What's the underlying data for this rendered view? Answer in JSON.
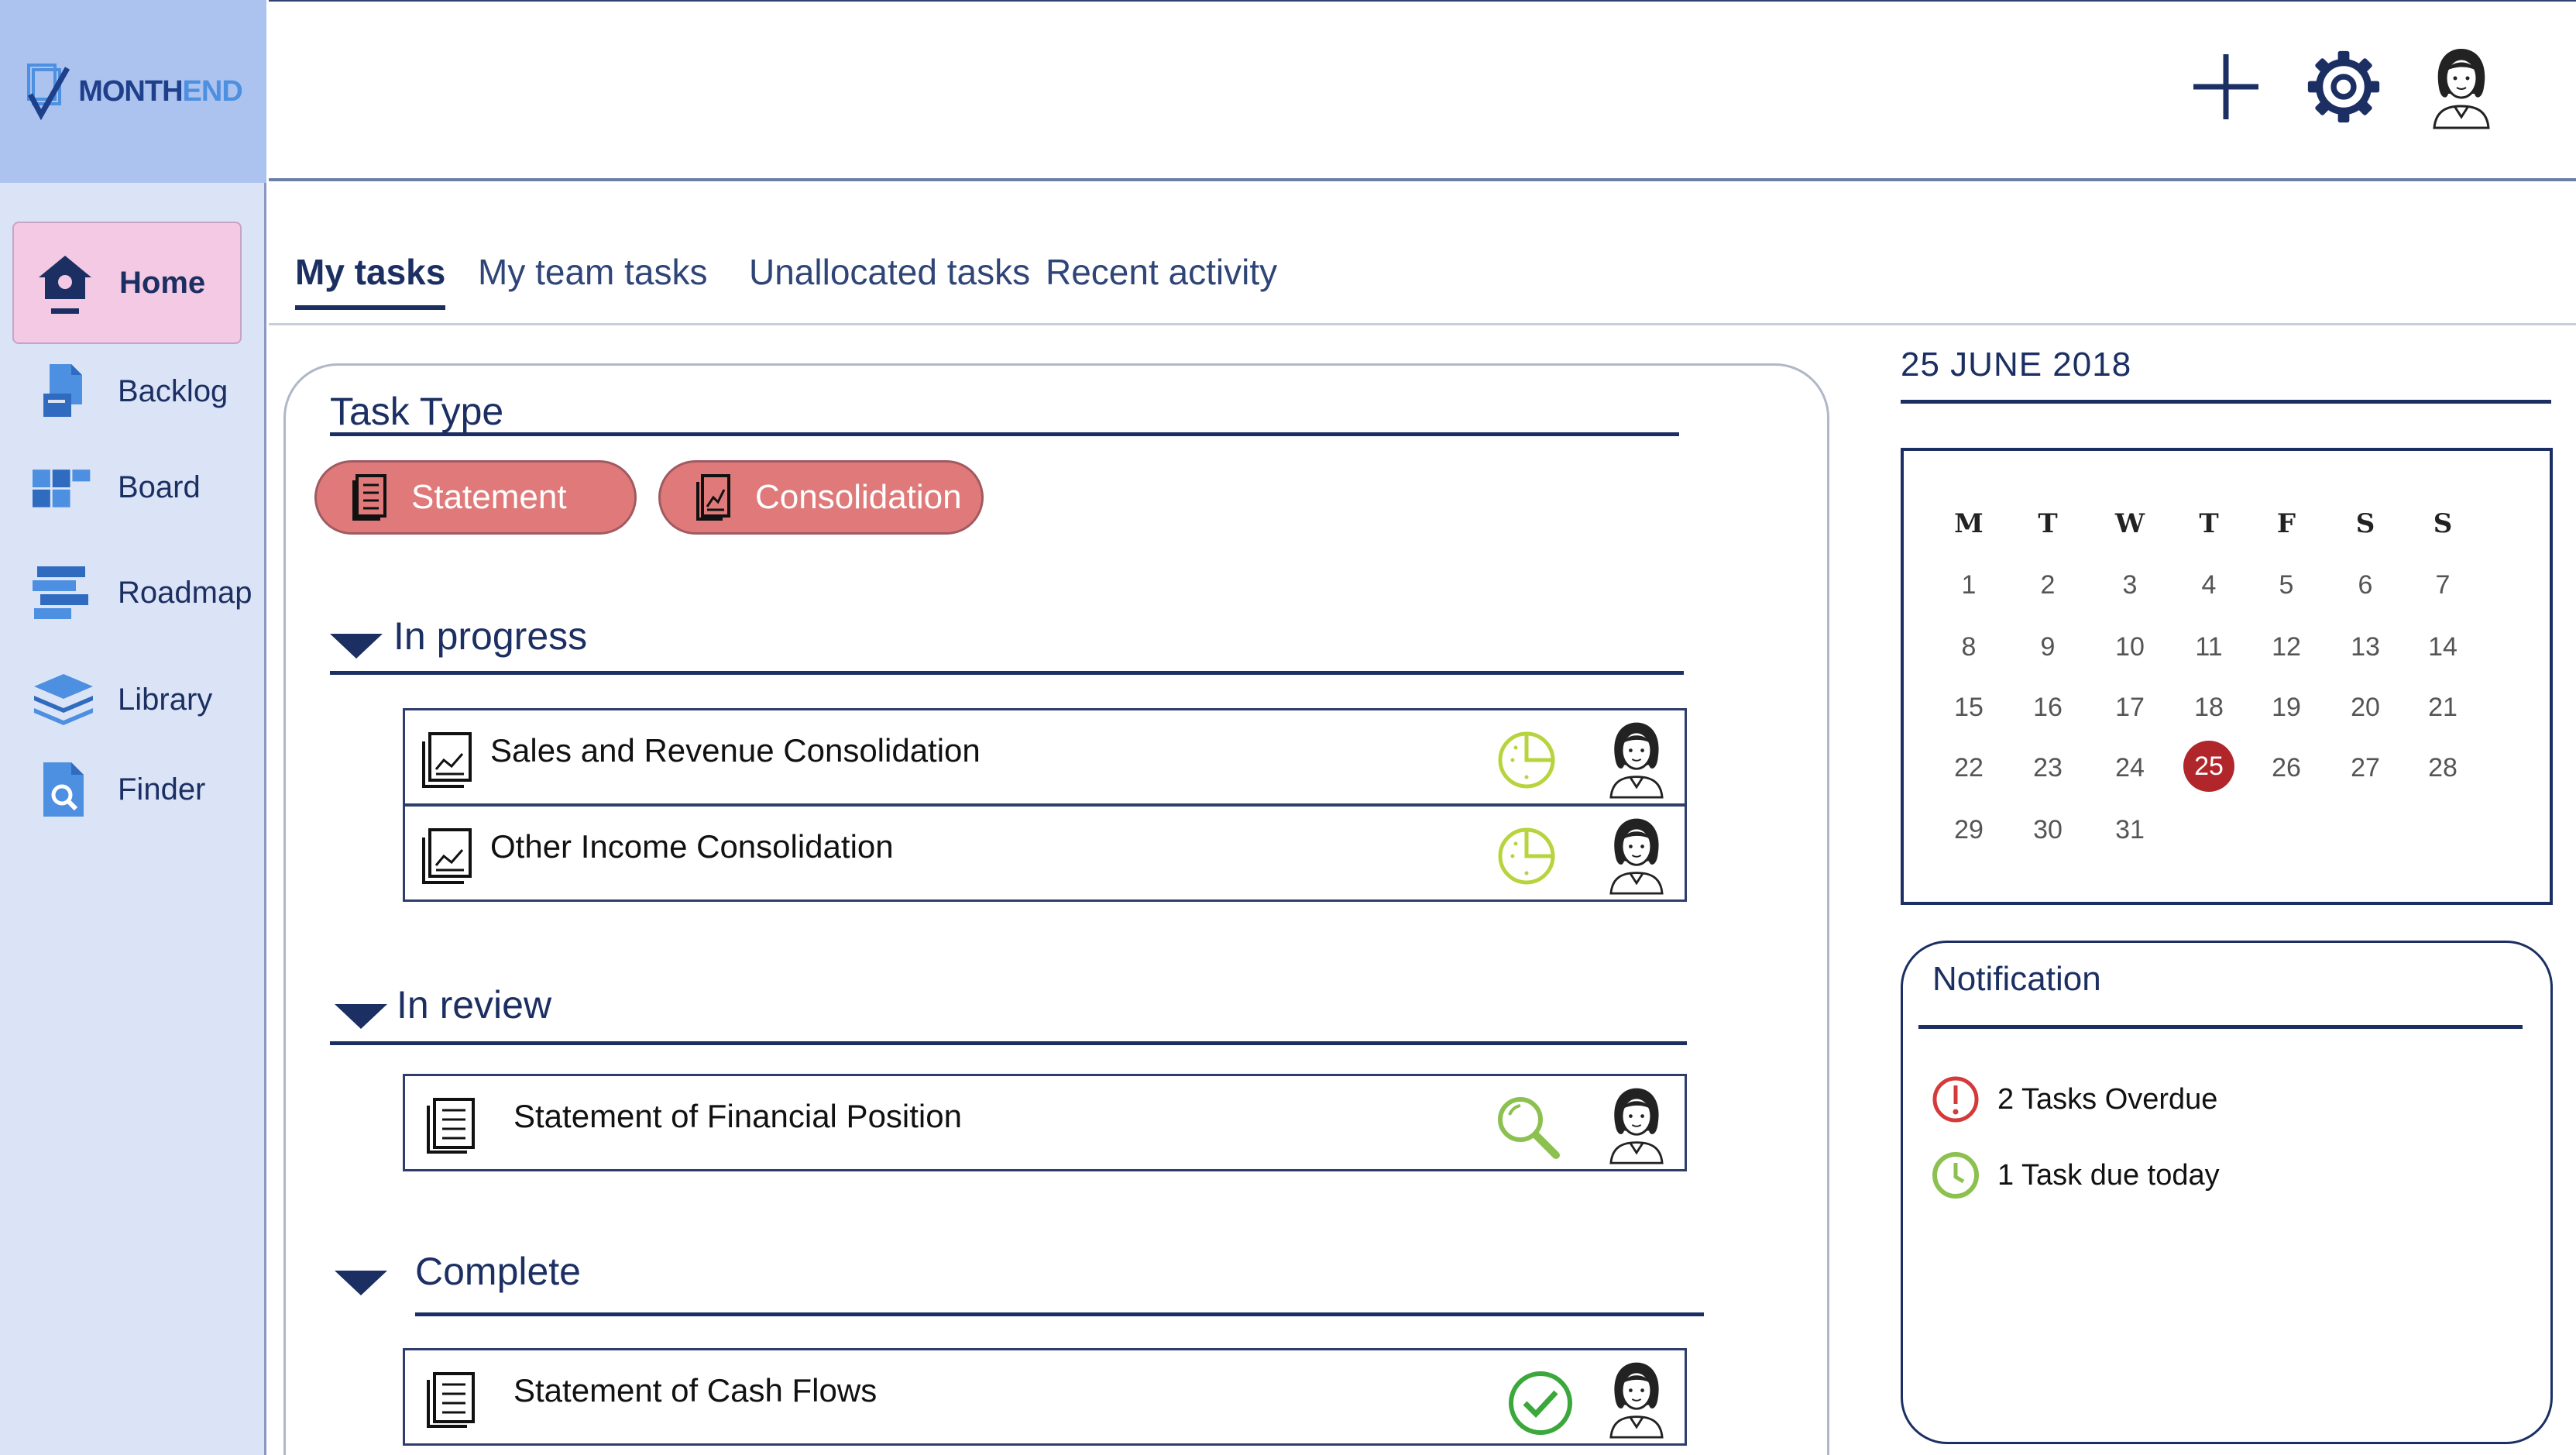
{
  "app": {
    "logo_text_a": "MONTH",
    "logo_text_b": "END"
  },
  "sidebar": {
    "items": [
      {
        "label": "Home",
        "icon": "house-icon",
        "active": true
      },
      {
        "label": "Backlog",
        "icon": "document-stack-icon"
      },
      {
        "label": "Board",
        "icon": "board-grid-icon"
      },
      {
        "label": "Roadmap",
        "icon": "roadmap-bars-icon"
      },
      {
        "label": "Library",
        "icon": "layers-icon"
      },
      {
        "label": "Finder",
        "icon": "document-search-icon"
      }
    ]
  },
  "header": {
    "actions": [
      "plus-icon",
      "gear-icon",
      "user-avatar-icon"
    ]
  },
  "tabs": [
    {
      "label": "My tasks",
      "active": true
    },
    {
      "label": "My team tasks"
    },
    {
      "label": "Unallocated tasks"
    },
    {
      "label": "Recent activity"
    }
  ],
  "task_type": {
    "heading": "Task Type",
    "chips": [
      {
        "label": "Statement",
        "icon": "statement-doc-icon"
      },
      {
        "label": "Consolidation",
        "icon": "consolidation-doc-icon"
      }
    ]
  },
  "sections": [
    {
      "title": "In progress",
      "tasks": [
        {
          "name": "Sales and Revenue Consolidation",
          "type_icon": "chart-doc-icon",
          "status_icon": "progress-clock-icon"
        },
        {
          "name": "Other Income Consolidation",
          "type_icon": "chart-doc-icon",
          "status_icon": "progress-clock-icon"
        }
      ]
    },
    {
      "title": "In review",
      "tasks": [
        {
          "name": "Statement of Financial Position",
          "type_icon": "statement-doc-icon",
          "status_icon": "magnifier-icon"
        }
      ]
    },
    {
      "title": "Complete",
      "tasks": [
        {
          "name": "Statement of Cash Flows",
          "type_icon": "statement-doc-icon",
          "status_icon": "check-circle-icon"
        }
      ]
    }
  ],
  "calendar": {
    "date_title": "25 JUNE 2018",
    "weekdays": [
      "M",
      "T",
      "W",
      "T",
      "F",
      "S",
      "S"
    ],
    "days": [
      1,
      2,
      3,
      4,
      5,
      6,
      7,
      8,
      9,
      10,
      11,
      12,
      13,
      14,
      15,
      16,
      17,
      18,
      19,
      20,
      21,
      22,
      23,
      24,
      25,
      26,
      27,
      28,
      29,
      30,
      31
    ],
    "today": 25,
    "today_color": "#b0262b"
  },
  "notification": {
    "title": "Notification",
    "items": [
      {
        "text": "2 Tasks Overdue",
        "icon": "alert-circle-icon",
        "color": "#d43a3a"
      },
      {
        "text": "1 Task due today",
        "icon": "clock-icon",
        "color": "#8cc152"
      }
    ]
  },
  "colors": {
    "navy": "#1c2f63",
    "sidebar_bg": "#dbe4f6",
    "logo_bg": "#adc3ef",
    "active_nav_bg": "#f3c9e3",
    "chip_bg": "#e07a7a",
    "status_green": "#8cc152"
  }
}
